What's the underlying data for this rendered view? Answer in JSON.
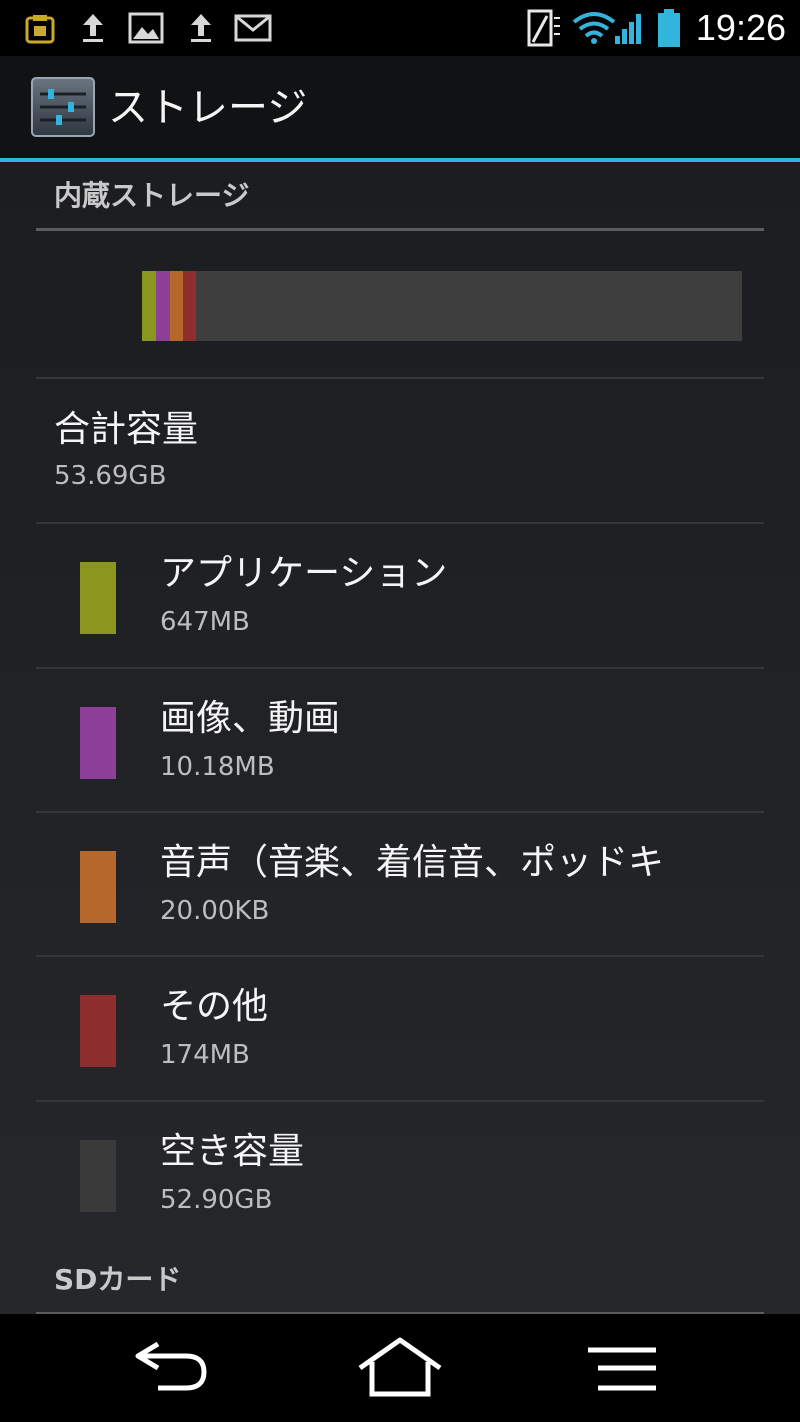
{
  "status_bar": {
    "time": "19:26",
    "left_icons": [
      "notification-app-icon",
      "upload-arrow-icon",
      "image-icon",
      "upload-arrow-icon",
      "gmail-icon"
    ],
    "right_icons": [
      "sim-signal-icon",
      "wifi-icon",
      "cell-signal-icon",
      "battery-icon"
    ]
  },
  "action_bar": {
    "title": "ストレージ",
    "icon": "settings-sliders-icon",
    "accent_color": "#32b5dc"
  },
  "internal_storage": {
    "header": "内蔵ストレージ",
    "total": {
      "label": "合計容量",
      "value": "53.69GB"
    },
    "categories": [
      {
        "label": "アプリケーション",
        "value": "647MB",
        "color": "#8b961e"
      },
      {
        "label": "画像、動画",
        "value": "10.18MB",
        "color": "#8e3f9a"
      },
      {
        "label": "音声（音楽、着信音、ポッドキ",
        "value": "20.00KB",
        "color": "#b5682a"
      },
      {
        "label": "その他",
        "value": "174MB",
        "color": "#8e2e2e"
      },
      {
        "label": "空き容量",
        "value": "52.90GB",
        "color": "#3a3a3a"
      }
    ]
  },
  "sd_card": {
    "header": "SDカード"
  },
  "nav_bar": {
    "icons": [
      "back-icon",
      "home-icon",
      "menu-icon"
    ]
  }
}
